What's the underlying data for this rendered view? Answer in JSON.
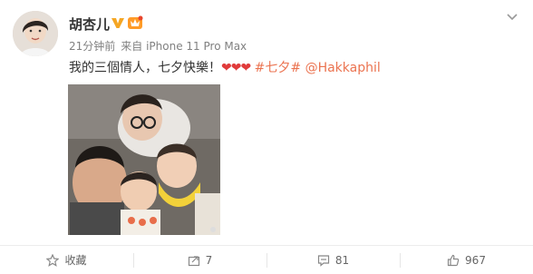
{
  "post": {
    "username": "胡杏儿",
    "meta": {
      "time": "21分钟前",
      "source": "来自 iPhone 11 Pro Max"
    },
    "content": {
      "text": "我的三個情人，七夕快樂！",
      "hearts": "❤❤❤",
      "hashtag": "#七夕#",
      "mention": "@Hakkaphil"
    },
    "photo_icon": "image-photo",
    "colors": {
      "link": "#eb7350",
      "heart": "#e03b3b",
      "verified": "#f5a623",
      "meta": "#808080"
    }
  },
  "actions": [
    {
      "icon": "star-icon",
      "label": "收藏"
    },
    {
      "icon": "share-icon",
      "label": "7"
    },
    {
      "icon": "comment-icon",
      "label": "81"
    },
    {
      "icon": "thumbs-up-icon",
      "label": "967"
    }
  ]
}
